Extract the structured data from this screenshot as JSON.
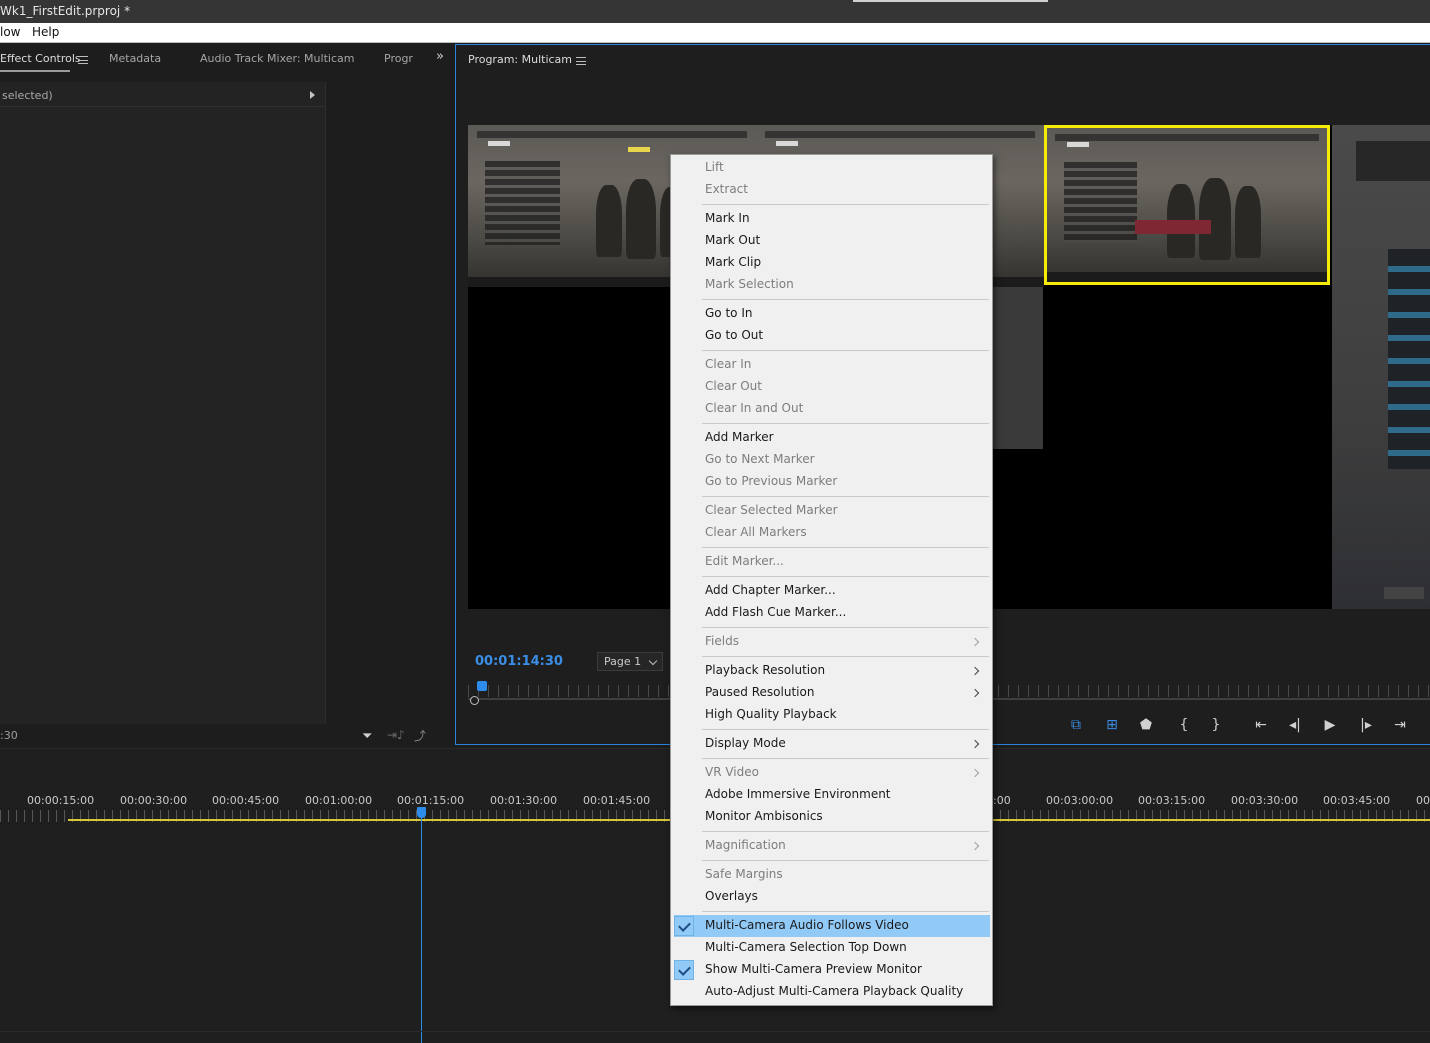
{
  "window": {
    "title": "Wk1_FirstEdit.prproj *"
  },
  "menubar": {
    "items": [
      "low",
      "Help"
    ]
  },
  "left_panel": {
    "tabs": [
      "Effect Controls",
      "Metadata",
      "Audio Track Mixer: Multicam",
      "Progr"
    ],
    "clip_label": "selected)",
    "footer_time": ":30"
  },
  "program_monitor": {
    "title": "Program: Multicam",
    "timecode": "00:01:14:30",
    "page_select": "Page 1"
  },
  "timeline": {
    "ruler_times": [
      "00:00:15:00",
      "00:00:30:00",
      "00:00:45:00",
      "00:01:00:00",
      "00:01:15:00",
      "00:01:30:00",
      "00:01:45:00",
      ":00",
      "00:03:00:00",
      "00:03:15:00",
      "00:03:30:00",
      "00:03:45:00",
      "00:"
    ]
  },
  "transport_icons": [
    "multicam-toggle-icon",
    "safe-margins-icon",
    "marker-icon",
    "mark-in-icon",
    "mark-out-icon",
    "go-to-in-icon",
    "step-back-icon",
    "play-icon",
    "step-forward-icon",
    "go-to-out-icon"
  ],
  "context_menu": {
    "items": [
      {
        "label": "Lift",
        "disabled": true
      },
      {
        "label": "Extract",
        "disabled": true
      },
      {
        "label": "Mark In"
      },
      {
        "label": "Mark Out"
      },
      {
        "label": "Mark Clip"
      },
      {
        "label": "Mark Selection",
        "disabled": true
      },
      {
        "label": "Go to In"
      },
      {
        "label": "Go to Out"
      },
      {
        "label": "Clear In",
        "disabled": true
      },
      {
        "label": "Clear Out",
        "disabled": true
      },
      {
        "label": "Clear In and Out",
        "disabled": true
      },
      {
        "label": "Add Marker"
      },
      {
        "label": "Go to Next Marker",
        "disabled": true
      },
      {
        "label": "Go to Previous Marker",
        "disabled": true
      },
      {
        "label": "Clear Selected Marker",
        "disabled": true
      },
      {
        "label": "Clear All Markers",
        "disabled": true
      },
      {
        "label": "Edit Marker...",
        "disabled": true
      },
      {
        "label": "Add Chapter Marker..."
      },
      {
        "label": "Add Flash Cue Marker..."
      },
      {
        "label": "Fields",
        "disabled": true,
        "submenu": true
      },
      {
        "label": "Playback Resolution",
        "submenu": true
      },
      {
        "label": "Paused Resolution",
        "submenu": true
      },
      {
        "label": "High Quality Playback"
      },
      {
        "label": "Display Mode",
        "submenu": true
      },
      {
        "label": "VR Video",
        "disabled": true,
        "submenu": true
      },
      {
        "label": "Adobe Immersive Environment"
      },
      {
        "label": "Monitor Ambisonics"
      },
      {
        "label": "Magnification",
        "disabled": true,
        "submenu": true
      },
      {
        "label": "Safe Margins",
        "disabled": true
      },
      {
        "label": "Overlays"
      },
      {
        "label": "Multi-Camera Audio Follows Video",
        "checked": true,
        "highlighted": true
      },
      {
        "label": "Multi-Camera Selection Top Down"
      },
      {
        "label": "Show Multi-Camera Preview Monitor",
        "checked": true
      },
      {
        "label": "Auto-Adjust Multi-Camera Playback Quality"
      }
    ]
  },
  "colors": {
    "accent": "#2d8ceb",
    "timecode": "#3a8ee6",
    "active_camera_border": "#f6ea06",
    "menu_highlight": "#91c9f7",
    "work_area": "#d7c53a"
  }
}
